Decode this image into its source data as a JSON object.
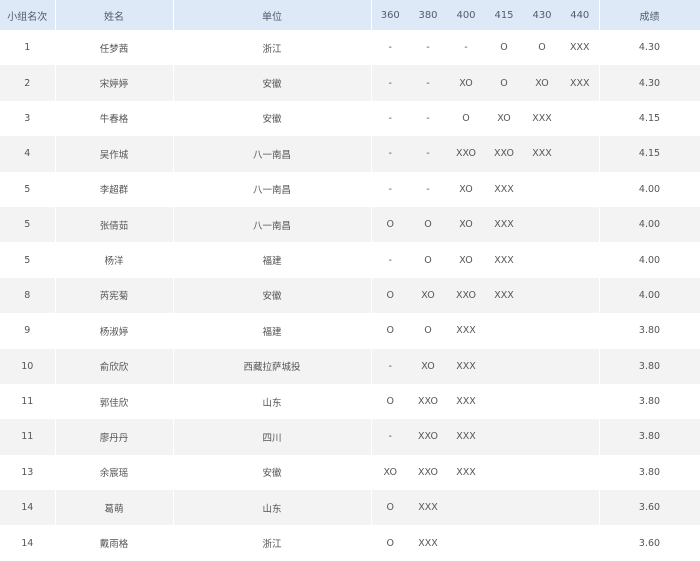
{
  "headers": [
    "小组名次",
    "姓名",
    "单位",
    "360",
    "380",
    "400",
    "415",
    "430",
    "440",
    "成绩"
  ],
  "rows": [
    {
      "rank": "1",
      "name": "任梦茜",
      "unit": "浙江",
      "attempts": [
        "-",
        "-",
        "-",
        "O",
        "O",
        "XXX"
      ],
      "result": "4.30"
    },
    {
      "rank": "2",
      "name": "宋婷婷",
      "unit": "安徽",
      "attempts": [
        "-",
        "-",
        "XO",
        "O",
        "XO",
        "XXX"
      ],
      "result": "4.30"
    },
    {
      "rank": "3",
      "name": "牛春格",
      "unit": "安徽",
      "attempts": [
        "-",
        "-",
        "O",
        "XO",
        "XXX",
        ""
      ],
      "result": "4.15"
    },
    {
      "rank": "4",
      "name": "吴作城",
      "unit": "八一南昌",
      "attempts": [
        "-",
        "-",
        "XXO",
        "XXO",
        "XXX",
        ""
      ],
      "result": "4.15"
    },
    {
      "rank": "5",
      "name": "李超群",
      "unit": "八一南昌",
      "attempts": [
        "-",
        "-",
        "XO",
        "XXX",
        "",
        ""
      ],
      "result": "4.00"
    },
    {
      "rank": "5",
      "name": "张倩茹",
      "unit": "八一南昌",
      "attempts": [
        "O",
        "O",
        "XO",
        "XXX",
        "",
        ""
      ],
      "result": "4.00"
    },
    {
      "rank": "5",
      "name": "杨洋",
      "unit": "福建",
      "attempts": [
        "-",
        "O",
        "XO",
        "XXX",
        "",
        ""
      ],
      "result": "4.00"
    },
    {
      "rank": "8",
      "name": "芮宪菊",
      "unit": "安徽",
      "attempts": [
        "O",
        "XO",
        "XXO",
        "XXX",
        "",
        ""
      ],
      "result": "4.00"
    },
    {
      "rank": "9",
      "name": "杨淑婷",
      "unit": "福建",
      "attempts": [
        "O",
        "O",
        "XXX",
        "",
        "",
        ""
      ],
      "result": "3.80"
    },
    {
      "rank": "10",
      "name": "俞欣欣",
      "unit": "西藏拉萨城投",
      "attempts": [
        "-",
        "XO",
        "XXX",
        "",
        "",
        ""
      ],
      "result": "3.80"
    },
    {
      "rank": "11",
      "name": "郭佳欣",
      "unit": "山东",
      "attempts": [
        "O",
        "XXO",
        "XXX",
        "",
        "",
        ""
      ],
      "result": "3.80"
    },
    {
      "rank": "11",
      "name": "廖丹丹",
      "unit": "四川",
      "attempts": [
        "-",
        "XXO",
        "XXX",
        "",
        "",
        ""
      ],
      "result": "3.80"
    },
    {
      "rank": "13",
      "name": "余宸瑶",
      "unit": "安徽",
      "attempts": [
        "XO",
        "XXO",
        "XXX",
        "",
        "",
        ""
      ],
      "result": "3.80"
    },
    {
      "rank": "14",
      "name": "葛萌",
      "unit": "山东",
      "attempts": [
        "O",
        "XXX",
        "",
        "",
        "",
        ""
      ],
      "result": "3.60"
    },
    {
      "rank": "14",
      "name": "戴雨格",
      "unit": "浙江",
      "attempts": [
        "O",
        "XXX",
        "",
        "",
        "",
        ""
      ],
      "result": "3.60"
    }
  ]
}
